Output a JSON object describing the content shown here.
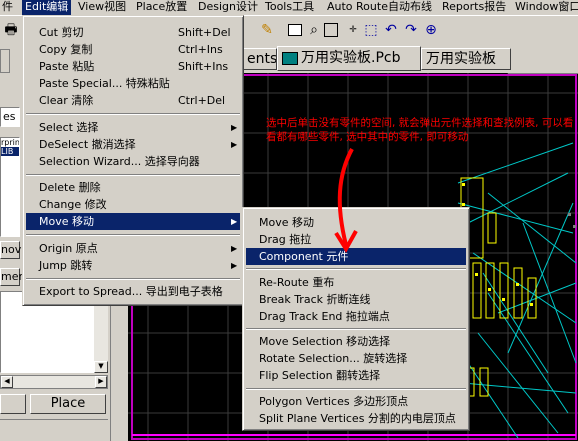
{
  "menubar": {
    "items": [
      "件",
      "Edit编辑",
      "View视图",
      "Place放置",
      "Design设计",
      "Tools工具",
      "Auto Route自动布线",
      "Reports报告",
      "Window窗口"
    ]
  },
  "tabs": {
    "ents": "ents",
    "pcb": "万用实验板.Pcb",
    "pcb2": "万用实验板"
  },
  "left": {
    "es": "es",
    "tree1": "rprin",
    "tree2": "LIB",
    "nov": "nov",
    "men": "men",
    "place": "Place"
  },
  "edit_menu": {
    "cut": {
      "label": "Cut 剪切",
      "shortcut": "Shift+Del"
    },
    "copy": {
      "label": "Copy 复制",
      "shortcut": "Ctrl+Ins"
    },
    "paste": {
      "label": "Paste 粘贴",
      "shortcut": "Shift+Ins"
    },
    "paste_special": {
      "label": "Paste Special... 特殊粘贴"
    },
    "clear": {
      "label": "Clear 清除",
      "shortcut": "Ctrl+Del"
    },
    "select": {
      "label": "Select 选择"
    },
    "deselect": {
      "label": "DeSelect 撤消选择"
    },
    "selection_wizard": {
      "label": "Selection Wizard... 选择导向器"
    },
    "delete": {
      "label": "Delete 删除"
    },
    "change": {
      "label": "Change 修改"
    },
    "move": {
      "label": "Move 移动"
    },
    "origin": {
      "label": "Origin 原点"
    },
    "jump": {
      "label": "Jump 跳转"
    },
    "export": {
      "label": "Export to Spread... 导出到电子表格"
    }
  },
  "move_menu": {
    "move": "Move 移动",
    "drag": "Drag 拖拉",
    "component": "Component 元件",
    "reroute": "Re-Route 重布",
    "break_track": "Break Track 折断连线",
    "drag_track_end": "Drag Track End 拖拉端点",
    "move_selection": "Move Selection 移动选择",
    "rotate_selection": "Rotate Selection... 旋转选择",
    "flip_selection": "Flip Selection 翻转选择",
    "polygon_vertices": "Polygon Vertices 多边形顶点",
    "split_plane_vertices": "Split Plane Vertices 分割的内电层顶点"
  },
  "annotation": {
    "text": "选中后单击没有零件的空间, 就会弹出元件选择和查找例表, 可以看看都有哪些零件, 选中其中的零件, 即可移动"
  },
  "colors": {
    "highlight": "#0a246a",
    "canvas": "#000000",
    "annotation": "#ff0000",
    "track_cyan": "#00c8c8",
    "component_yellow": "#ffff00"
  }
}
